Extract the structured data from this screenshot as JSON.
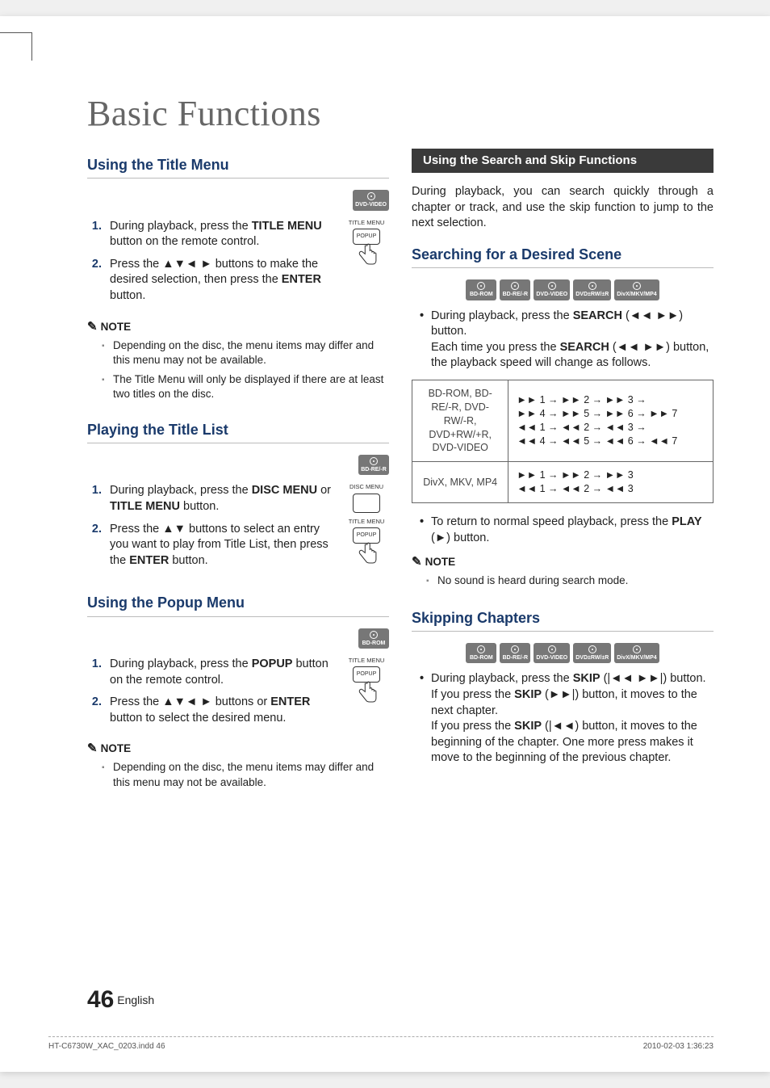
{
  "chapter": "Basic Functions",
  "left": {
    "s1": {
      "head": "Using the Title Menu",
      "badges": [
        "DVD-VIDEO"
      ],
      "steps": [
        {
          "pre": "During playback, press the ",
          "b": "TITLE MENU",
          "post": " button on the remote control."
        },
        {
          "pre": "Press the ▲▼◄ ► buttons to make the desired selection, then press the ",
          "b": "ENTER",
          "post": " button."
        }
      ],
      "note_head": "NOTE",
      "notes": [
        "Depending on the disc, the menu items may differ and this menu may not be available.",
        "The Title Menu will only be displayed if there are at least two titles on the disc."
      ],
      "fig": {
        "l1": "TITLE MENU",
        "l2": "POPUP"
      }
    },
    "s2": {
      "head": "Playing the Title List",
      "badges": [
        "BD-RE/-R"
      ],
      "steps": [
        {
          "pre": "During playback, press the ",
          "b": "DISC MENU",
          "mid": " or ",
          "b2": "TITLE MENU",
          "post": " button."
        },
        {
          "pre": "Press the ▲▼ buttons to select an entry you want to play from Title List, then press the ",
          "b": "ENTER",
          "post": " button."
        }
      ],
      "fig": {
        "l0": "DISC MENU",
        "l1": "TITLE MENU",
        "l2": "POPUP"
      }
    },
    "s3": {
      "head": "Using the Popup Menu",
      "badges": [
        "BD-ROM"
      ],
      "steps": [
        {
          "pre": "During playback, press the ",
          "b": "POPUP",
          "post": " button on the remote control."
        },
        {
          "pre": "Press the ▲▼◄ ► buttons or ",
          "b": "ENTER",
          "post": " button to select the desired menu."
        }
      ],
      "note_head": "NOTE",
      "notes": [
        "Depending on the disc, the menu items may differ and this menu may not be available."
      ],
      "fig": {
        "l1": "TITLE MENU",
        "l2": "POPUP"
      }
    }
  },
  "right": {
    "topic": "Using the Search and Skip Functions",
    "intro": "During playback, you can search quickly through a chapter or track, and use the skip function to jump to the next selection.",
    "s1": {
      "head": "Searching for a Desired Scene",
      "badges": [
        "BD-ROM",
        "BD-RE/-R",
        "DVD-VIDEO",
        "DVD±RW/±R",
        "DivX/MKV/MP4"
      ],
      "b1": {
        "pre": "During playback, press the ",
        "b": "SEARCH",
        "icons": " (◄◄ ►►) ",
        "post": "button."
      },
      "b2": {
        "pre": "Each time you press the ",
        "b": "SEARCH",
        "icons": " (◄◄ ►►) ",
        "post": "button, the playback speed will change as follows."
      },
      "table": [
        {
          "label": "BD-ROM, BD-RE/-R, DVD-RW/-R, DVD+RW/+R, DVD-VIDEO",
          "rows": [
            "►► 1 → ►► 2 → ►► 3 →",
            "►► 4 → ►► 5 → ►► 6 → ►► 7",
            "◄◄ 1 → ◄◄ 2 → ◄◄ 3 →",
            "◄◄ 4 → ◄◄ 5 → ◄◄ 6 → ◄◄ 7"
          ]
        },
        {
          "label": "DivX, MKV, MP4",
          "rows": [
            "►► 1 → ►► 2 → ►► 3",
            "◄◄ 1 → ◄◄ 2 → ◄◄ 3"
          ]
        }
      ],
      "b3": {
        "pre": "To return to normal speed playback, press the ",
        "b": "PLAY",
        "icons": " (►) ",
        "post": "button."
      },
      "note_head": "NOTE",
      "notes": [
        "No sound is heard during search mode."
      ]
    },
    "s2": {
      "head": "Skipping Chapters",
      "badges": [
        "BD-ROM",
        "BD-RE/-R",
        "DVD-VIDEO",
        "DVD±RW/±R",
        "DivX/MKV/MP4"
      ],
      "b1": {
        "pre": "During playback, press the ",
        "b": "SKIP",
        "icons": " (|◄◄ ►►|) ",
        "post": "button."
      },
      "b2": {
        "pre": "If you press the ",
        "b": "SKIP",
        "icons": " (►►|) ",
        "post": "button, it moves to the next chapter."
      },
      "b3": {
        "pre": "If you press the ",
        "b": "SKIP",
        "icons": " (|◄◄) ",
        "post": "button, it moves to the beginning of the chapter. One more press makes it move to the beginning of the previous chapter."
      }
    }
  },
  "footer": {
    "page": "46",
    "lang": "English"
  },
  "imprint": {
    "left": "HT-C6730W_XAC_0203.indd   46",
    "right": "2010-02-03   1:36:23"
  }
}
